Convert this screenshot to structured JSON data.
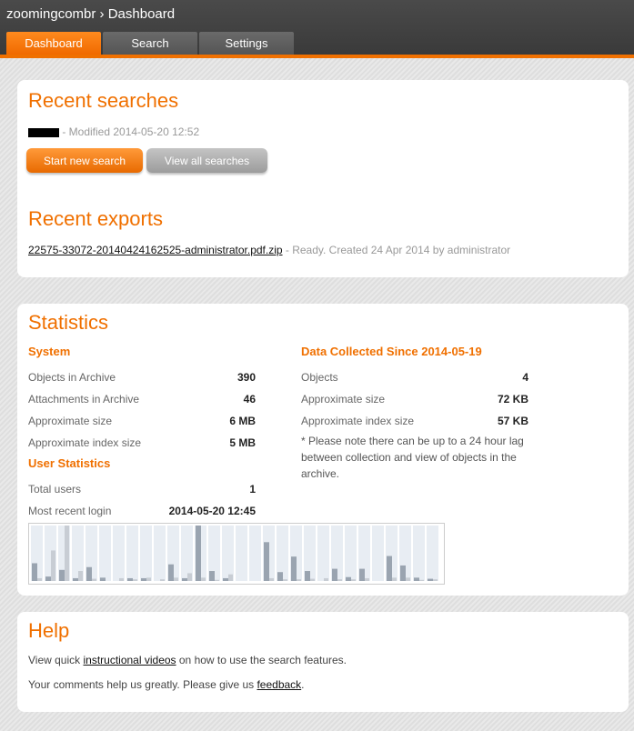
{
  "header": {
    "app_name": "zoomingcombr",
    "separator": "›",
    "page": "Dashboard"
  },
  "tabs": [
    {
      "label": "Dashboard",
      "active": true
    },
    {
      "label": "Search",
      "active": false
    },
    {
      "label": "Settings",
      "active": false
    }
  ],
  "recent_searches": {
    "title": "Recent searches",
    "modified_text": "- Modified 2014-05-20 12:52",
    "start_button": "Start new search",
    "view_button": "View all searches"
  },
  "recent_exports": {
    "title": "Recent exports",
    "file_link": "22575-33072-20140424162525-administrator.pdf.zip",
    "status_text": "- Ready. Created 24 Apr 2014 by administrator"
  },
  "statistics": {
    "title": "Statistics",
    "system": {
      "title": "System",
      "rows": [
        {
          "label": "Objects in Archive",
          "value": "390"
        },
        {
          "label": "Attachments in Archive",
          "value": "46"
        },
        {
          "label": "Approximate size",
          "value": "6 MB"
        },
        {
          "label": "Approximate index size",
          "value": "5 MB"
        }
      ]
    },
    "user": {
      "title": "User Statistics",
      "rows": [
        {
          "label": "Total users",
          "value": "1"
        },
        {
          "label": "Most recent login",
          "value": "2014-05-20 12:45"
        }
      ]
    },
    "collected": {
      "title": "Data Collected Since 2014-05-19",
      "rows": [
        {
          "label": "Objects",
          "value": "4"
        },
        {
          "label": "Approximate size",
          "value": "72 KB"
        },
        {
          "label": "Approximate index size",
          "value": "57 KB"
        }
      ],
      "note": "* Please note there can be up to a 24 hour lag between collection and view of objects in the archive."
    }
  },
  "help": {
    "title": "Help",
    "line1_prefix": "View quick ",
    "line1_link": "instructional videos",
    "line1_suffix": " on how to use the search features.",
    "line2_prefix": "Your comments help us greatly. Please give us ",
    "line2_link": "feedback",
    "line2_suffix": "."
  },
  "chart_data": {
    "type": "bar",
    "series": [
      {
        "values": [
          0.32,
          0.08,
          0.2,
          0.05,
          0.25,
          0.06,
          0.0,
          0.05,
          0.05,
          0.0,
          0.3,
          0.05,
          1.0,
          0.18,
          0.05,
          0.0,
          0.0,
          0.7,
          0.16,
          0.44,
          0.18,
          0.0,
          0.22,
          0.07,
          0.22,
          0.0,
          0.45,
          0.28,
          0.06,
          0.04,
          0.02,
          0.02,
          0.0,
          0.02,
          0.02,
          0.02,
          0.02,
          0.02,
          0.02,
          0.02,
          0.02,
          0.02,
          0.02,
          0.02,
          0.02
        ]
      },
      {
        "values": [
          0.05,
          0.55,
          1.0,
          0.18,
          0.04,
          0.0,
          0.05,
          0.03,
          0.06,
          0.03,
          0.06,
          0.14,
          0.06,
          0.02,
          0.12,
          0.0,
          0.0,
          0.05,
          0.03,
          0.03,
          0.04,
          0.05,
          0.03,
          0.03,
          0.05,
          0.0,
          0.06,
          0.06,
          0.02,
          0.03,
          0.02,
          0.02,
          0.0,
          0.02,
          0.02,
          0.02,
          0.02,
          0.02,
          0.02,
          0.02,
          0.02,
          0.02,
          0.02,
          0.02,
          0.02
        ]
      }
    ],
    "colors": {
      "primary": "#9aa4b0",
      "secondary": "#c8cdd4",
      "column_bg": "#e8edf3"
    }
  }
}
